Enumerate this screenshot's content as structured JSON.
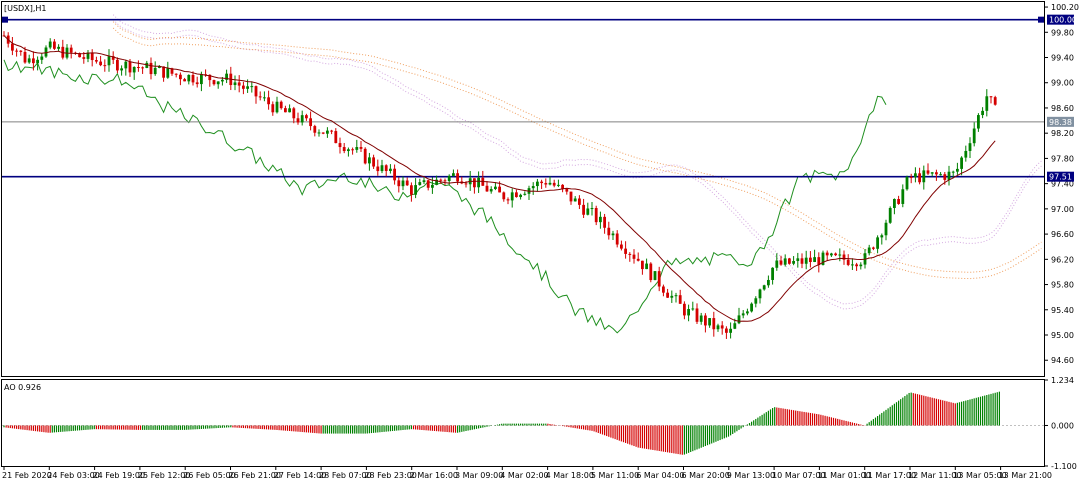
{
  "window": {
    "title": "[USDX],H1"
  },
  "colors": {
    "background": "#ffffff",
    "bull": "#008000",
    "bear": "#d40000",
    "ma": "#800000",
    "chikou": "#1f8f1f",
    "kumo_down": "#d4a8e0",
    "kumo_up": "#f0a060",
    "level_line": "#000080",
    "price_line": "#808080",
    "badge_blue": "#000080",
    "badge_gray": "#8090a0"
  },
  "price_axis": {
    "ticks": [
      "100.20",
      "99.80",
      "99.40",
      "99.00",
      "98.60",
      "98.20",
      "97.80",
      "97.40",
      "97.00",
      "96.60",
      "96.20",
      "95.80",
      "95.40",
      "95.00",
      "94.60"
    ],
    "ylim": [
      94.35,
      100.28
    ]
  },
  "levels": [
    {
      "value": 100.0,
      "label": "100.00",
      "kind": "horizontal-line"
    },
    {
      "value": 97.51,
      "label": "97.51",
      "kind": "horizontal-line"
    }
  ],
  "current_price": {
    "value": 98.38,
    "label": "98.38"
  },
  "indicator": {
    "title": "AO 0.926",
    "ticks": [
      "1.234",
      "0.000",
      "-1.100"
    ],
    "ylim": [
      -1.1,
      1.234
    ]
  },
  "time_axis": {
    "labels": [
      "21 Feb 2020",
      "24 Feb 03:00",
      "24 Feb 19:00",
      "25 Feb 12:00",
      "26 Feb 05:00",
      "26 Feb 21:00",
      "27 Feb 14:00",
      "28 Feb 07:00",
      "28 Feb 23:00",
      "2 Mar 16:00",
      "3 Mar 09:00",
      "4 Mar 02:00",
      "4 Mar 18:00",
      "5 Mar 11:00",
      "6 Mar 04:00",
      "6 Mar 20:00",
      "9 Mar 13:00",
      "10 Mar 07:00",
      "11 Mar 01:00",
      "11 Mar 17:00",
      "12 Mar 11:00",
      "13 Mar 05:00",
      "13 Mar 21:00"
    ]
  },
  "chart_data": {
    "type": "candlestick",
    "symbol": "USDX",
    "timeframe": "H1",
    "price_path": [
      {
        "date": "21 Feb 2020",
        "close": 99.75
      },
      {
        "date": "22 Feb 2020",
        "close": 99.35
      },
      {
        "date": "24 Feb 03:00",
        "close": 99.55
      },
      {
        "date": "24 Feb 19:00",
        "close": 99.35
      },
      {
        "date": "25 Feb 12:00",
        "close": 99.25
      },
      {
        "date": "26 Feb 05:00",
        "close": 99.1
      },
      {
        "date": "26 Feb 21:00",
        "close": 99.05
      },
      {
        "date": "27 Feb 14:00",
        "close": 98.6
      },
      {
        "date": "28 Feb 07:00",
        "close": 98.25
      },
      {
        "date": "28 Feb 23:00",
        "close": 97.8
      },
      {
        "date": "2 Mar 16:00",
        "close": 97.3
      },
      {
        "date": "3 Mar 09:00",
        "close": 97.55
      },
      {
        "date": "4 Mar 02:00",
        "close": 97.2
      },
      {
        "date": "4 Mar 18:00",
        "close": 97.45
      },
      {
        "date": "5 Mar 11:00",
        "close": 96.9
      },
      {
        "date": "6 Mar 04:00",
        "close": 96.2
      },
      {
        "date": "6 Mar 20:00",
        "close": 95.4
      },
      {
        "date": "9 Mar 13:00",
        "close": 95.0
      },
      {
        "date": "10 Mar 07:00",
        "close": 96.1
      },
      {
        "date": "11 Mar 01:00",
        "close": 96.2
      },
      {
        "date": "11 Mar 17:00",
        "close": 96.2
      },
      {
        "date": "12 Mar 11:00",
        "close": 97.5
      },
      {
        "date": "13 Mar 05:00",
        "close": 97.55
      },
      {
        "date": "13 Mar 14:00",
        "close": 98.8
      },
      {
        "date": "13 Mar 21:00",
        "close": 98.38
      }
    ],
    "ao_path": [
      {
        "date": "21 Feb 2020",
        "value": -0.05
      },
      {
        "date": "24 Feb 03:00",
        "value": -0.2
      },
      {
        "date": "24 Feb 19:00",
        "value": -0.1
      },
      {
        "date": "25 Feb 12:00",
        "value": -0.12
      },
      {
        "date": "26 Feb 05:00",
        "value": -0.12
      },
      {
        "date": "26 Feb 21:00",
        "value": -0.05
      },
      {
        "date": "27 Feb 14:00",
        "value": -0.12
      },
      {
        "date": "28 Feb 07:00",
        "value": -0.22
      },
      {
        "date": "28 Feb 23:00",
        "value": -0.22
      },
      {
        "date": "2 Mar 16:00",
        "value": -0.1
      },
      {
        "date": "3 Mar 09:00",
        "value": -0.2
      },
      {
        "date": "4 Mar 02:00",
        "value": 0.05
      },
      {
        "date": "4 Mar 18:00",
        "value": 0.05
      },
      {
        "date": "5 Mar 11:00",
        "value": -0.15
      },
      {
        "date": "6 Mar 04:00",
        "value": -0.6
      },
      {
        "date": "6 Mar 20:00",
        "value": -0.8
      },
      {
        "date": "9 Mar 13:00",
        "value": -0.3
      },
      {
        "date": "10 Mar 07:00",
        "value": 0.5
      },
      {
        "date": "11 Mar 01:00",
        "value": 0.3
      },
      {
        "date": "11 Mar 17:00",
        "value": 0.0
      },
      {
        "date": "12 Mar 11:00",
        "value": 0.9
      },
      {
        "date": "13 Mar 05:00",
        "value": 0.6
      },
      {
        "date": "13 Mar 21:00",
        "value": 0.926
      }
    ],
    "current_price": 98.38,
    "ao_current": 0.926,
    "levels": [
      100.0,
      97.51
    ],
    "overlays": [
      "candles",
      "moving-average",
      "ichimoku-cloud",
      "chikou-line",
      "awesome-oscillator"
    ],
    "grid": false
  }
}
